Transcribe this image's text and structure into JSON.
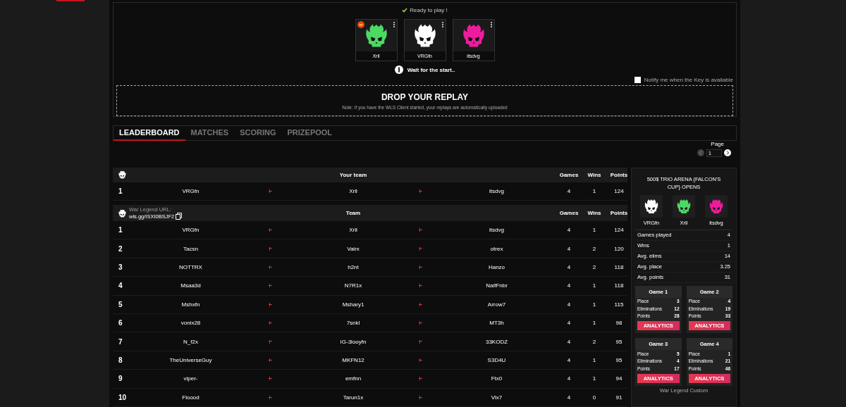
{
  "lobby": {
    "status": "Ready to play !",
    "players": [
      {
        "name": "Xrll",
        "color": "#4cd964",
        "leader": true
      },
      {
        "name": "VRGfn",
        "color": "#ffffff",
        "leader": false
      },
      {
        "name": "itsdvg",
        "color": "#ee1c9c",
        "leader": false
      }
    ],
    "wait": "Wait for the start..",
    "notify": {
      "label": "Notify me when the Key is available",
      "checked": false
    },
    "drop": {
      "title": "DROP YOUR REPLAY",
      "note": "Note: If you have the WLS Client started, your replays are automatically uploaded"
    }
  },
  "tabs": [
    {
      "label": "LEADERBOARD",
      "selected": true
    },
    {
      "label": "MATCHES",
      "selected": false
    },
    {
      "label": "SCORING",
      "selected": false
    },
    {
      "label": "PRIZEPOOL",
      "selected": false
    }
  ],
  "pager": {
    "label": "Page",
    "value": "1"
  },
  "your_team": {
    "title": "Your team",
    "columns": [
      "Games",
      "Wins",
      "Points"
    ],
    "row": {
      "rank": "1",
      "players": [
        "VRGfn",
        "Xrll",
        "itsdvg"
      ],
      "games": "4",
      "wins": "1",
      "points": "124"
    }
  },
  "leaderboard": {
    "url_label": "War Legend URL:",
    "url": "wls.gg/ISXI0BSJF2",
    "title": "Team",
    "columns": [
      "Games",
      "Wins",
      "Points"
    ],
    "rows": [
      {
        "rank": "1",
        "players": [
          "VRGfn",
          "Xrll",
          "itsdvg"
        ],
        "games": "4",
        "wins": "1",
        "points": "124"
      },
      {
        "rank": "2",
        "players": [
          "Tacsn",
          "Vairx",
          "otrex"
        ],
        "games": "4",
        "wins": "2",
        "points": "120"
      },
      {
        "rank": "3",
        "players": [
          "NOTTRX",
          "h2nt",
          "Hanzo"
        ],
        "games": "4",
        "wins": "2",
        "points": "118"
      },
      {
        "rank": "4",
        "players": [
          "Msaa3d",
          "N7R1x",
          "NaifFnbr"
        ],
        "games": "4",
        "wins": "1",
        "points": "118"
      },
      {
        "rank": "5",
        "players": [
          "Mshxfn",
          "Mshary1",
          "Arrow7"
        ],
        "games": "4",
        "wins": "1",
        "points": "115"
      },
      {
        "rank": "6",
        "players": [
          "vonix28",
          "7snkl",
          "MT3h"
        ],
        "games": "4",
        "wins": "1",
        "points": "98"
      },
      {
        "rank": "7",
        "players": [
          "N_f2x",
          "IG-3looyfn",
          "33KODZ"
        ],
        "games": "4",
        "wins": "2",
        "points": "95"
      },
      {
        "rank": "8",
        "players": [
          "TheUniverseGuy",
          "MKFN12",
          "S3D4U"
        ],
        "games": "4",
        "wins": "1",
        "points": "95"
      },
      {
        "rank": "9",
        "players": [
          "viper-",
          "emfnn",
          "Ftx0"
        ],
        "games": "4",
        "wins": "1",
        "points": "94"
      },
      {
        "rank": "10",
        "players": [
          "Floood",
          "Tarun1x",
          "Vix7"
        ],
        "games": "4",
        "wins": "0",
        "points": "91"
      }
    ]
  },
  "sidebar": {
    "title": "500$ TRIO ARENA {FALCON'S CUP} OPENS",
    "players": [
      {
        "name": "VRGfn",
        "color": "#ffffff"
      },
      {
        "name": "Xrll",
        "color": "#4cd964"
      },
      {
        "name": "itsdvg",
        "color": "#ee1c9c"
      }
    ],
    "stats": [
      {
        "label": "Games played",
        "value": "4"
      },
      {
        "label": "Wins",
        "value": "1"
      },
      {
        "label": "Avg. elims",
        "value": "14"
      },
      {
        "label": "Avg. place",
        "value": "3.25"
      },
      {
        "label": "Avg. points",
        "value": "31"
      }
    ],
    "games": [
      {
        "title": "Game 1",
        "place_label": "Place",
        "place": "3",
        "elims_label": "Eliminations",
        "elims": "12",
        "points_label": "Points",
        "points": "28",
        "button": "ANALYTICS"
      },
      {
        "title": "Game 2",
        "place_label": "Place",
        "place": "4",
        "elims_label": "Eliminations",
        "elims": "19",
        "points_label": "Points",
        "points": "33",
        "button": "ANALYTICS"
      },
      {
        "title": "Game 3",
        "place_label": "Place",
        "place": "5",
        "elims_label": "Eliminations",
        "elims": "4",
        "points_label": "Points",
        "points": "17",
        "button": "ANALYTICS"
      },
      {
        "title": "Game 4",
        "place_label": "Place",
        "place": "1",
        "elims_label": "Eliminations",
        "elims": "21",
        "points_label": "Points",
        "points": "46",
        "button": "ANALYTICS"
      }
    ],
    "footer": "War Legend Custom"
  }
}
